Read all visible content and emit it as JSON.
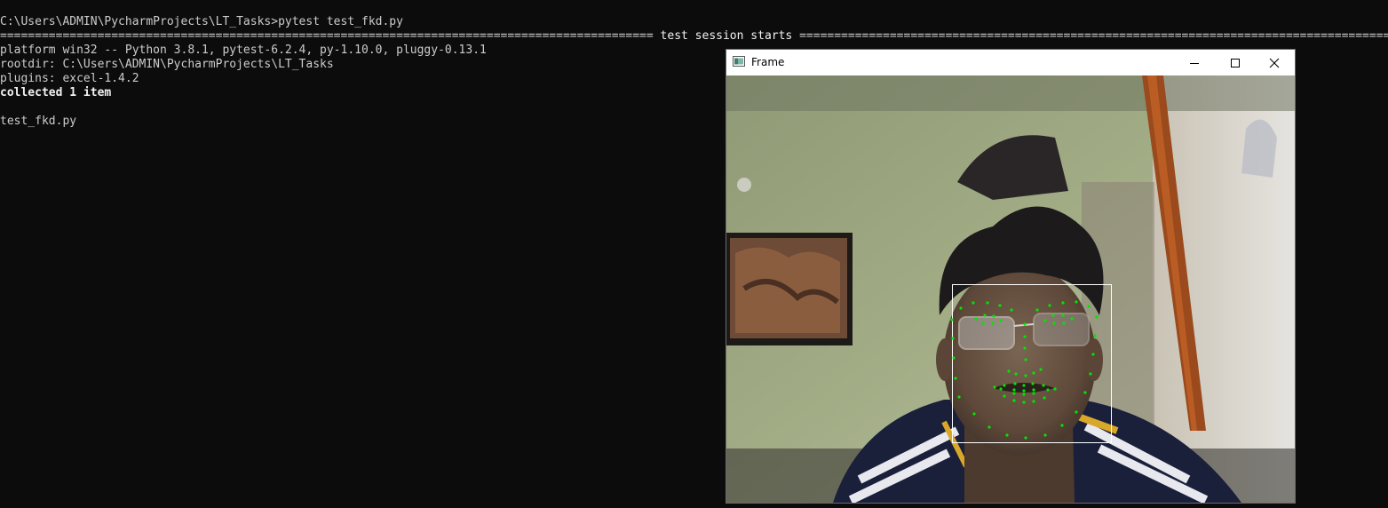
{
  "terminal": {
    "prompt_line": "C:\\Users\\ADMIN\\PycharmProjects\\LT_Tasks>pytest test_fkd.py",
    "separator_left": "==============================================================================================",
    "separator_label": " test session starts ",
    "separator_right": "==============================================================================================",
    "platform_line": "platform win32 -- Python 3.8.1, pytest-6.2.4, py-1.10.0, pluggy-0.13.1",
    "rootdir_line": "rootdir: C:\\Users\\ADMIN\\PycharmProjects\\LT_Tasks",
    "plugins_line": "plugins: excel-1.4.2",
    "collected_line": "collected 1 item",
    "test_file_line": "test_fkd.py"
  },
  "cv_window": {
    "title": "Frame",
    "icon": "app-window-icon",
    "controls": {
      "minimize_icon": "minimize-icon",
      "maximize_icon": "maximize-icon",
      "close_icon": "close-icon"
    },
    "overlay_colors": {
      "face_box": "#ffffff",
      "landmarks": "#00e600"
    }
  }
}
